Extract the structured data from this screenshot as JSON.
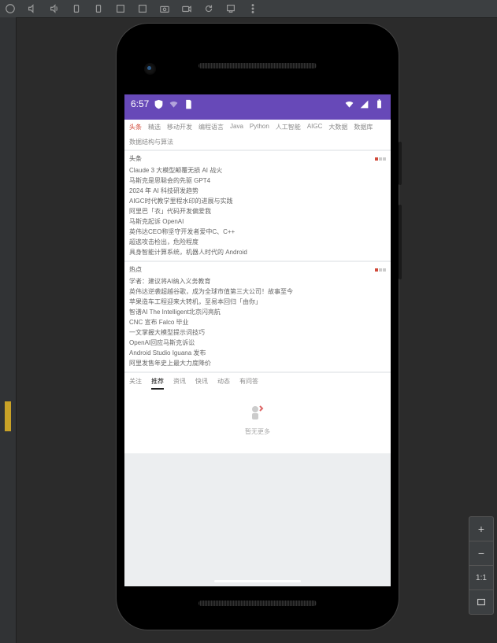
{
  "status_bar": {
    "time": "6:57"
  },
  "categories": [
    {
      "label": "头条",
      "active": true
    },
    {
      "label": "精选"
    },
    {
      "label": "移动开发"
    },
    {
      "label": "编程语言"
    },
    {
      "label": "Java"
    },
    {
      "label": "Python"
    },
    {
      "label": "人工智能"
    },
    {
      "label": "AIGC"
    },
    {
      "label": "大数据"
    },
    {
      "label": "数据库"
    },
    {
      "label": "数据结构与算法"
    }
  ],
  "sections": [
    {
      "title": "头条",
      "dots": [
        true,
        false,
        false
      ],
      "articles": [
        "Claude 3 大模型颠覆无损 AI 战火",
        "马斯克是思聪会的先驱 GPT4",
        "2024 年 AI 科技研发趋势",
        "AIGC时代教学里程水印的进展与实践",
        "阿里巴「衣」代码开发偏爱我",
        "马斯克起诉 OpenAI",
        "英伟达CEO称坚守开发者爱中C、C++",
        "超逘攻击检出，危险程度",
        "具身智能计算系统，机器人时代的 Android"
      ]
    },
    {
      "title": "热点",
      "dots": [
        true,
        false,
        false
      ],
      "articles": [
        "学者：建议将AI纳入义务教育",
        "英伟达逆袭超越谷歌，成为全球市值第三大公司！故事至今",
        "苹果造车工程迎来大转机，至易本回归「由你」",
        "智谱AI The Intelligent北京闪亮航",
        "CNC 宣布 Falco 毕业",
        "一文掌握大模型提示词技巧",
        "OpenAI回应马斯克诉讼",
        "Android Studio Iguana 发布",
        "阿里发售年史上最大力度降价"
      ]
    }
  ],
  "feed_tabs": [
    {
      "label": "关注"
    },
    {
      "label": "推荐",
      "active": true
    },
    {
      "label": "资讯"
    },
    {
      "label": "快讯"
    },
    {
      "label": "动态"
    },
    {
      "label": "有问答"
    }
  ],
  "empty_state": {
    "text": "暂无更多"
  },
  "zoom": {
    "plus": "+",
    "minus": "−",
    "oneToOne": "1:1"
  }
}
